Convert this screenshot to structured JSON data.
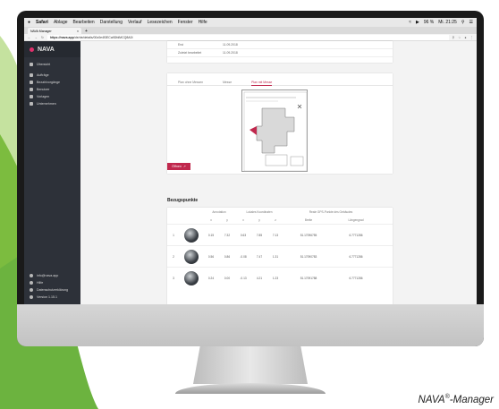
{
  "menubar": {
    "app": "Safari",
    "items": [
      "Ablage",
      "Bearbeiten",
      "Darstellung",
      "Verlauf",
      "Lesezeichen",
      "Fenster",
      "Hilfe"
    ],
    "battery": "96 %",
    "clock": "Mi. 21:25"
  },
  "browser": {
    "tab_title": "NAVA Manager",
    "url_domain": "https://nava.app",
    "url_path": "/de/de/details/00c0e4f3ECa9DfdMCQ8A0l"
  },
  "sidebar": {
    "brand": "NAVA",
    "items": [
      {
        "label": "Übersicht"
      },
      {
        "label": "Aufträge"
      },
      {
        "label": "Bezahlvorgänge"
      },
      {
        "label": "Benutzer"
      },
      {
        "label": "Vorlagen"
      },
      {
        "label": "Unternehmen"
      }
    ],
    "footer": [
      {
        "label": "info@nava.app"
      },
      {
        "label": "Hilfe"
      },
      {
        "label": "Datenschutzerklärung"
      },
      {
        "label": "Version 1.15.1"
      }
    ]
  },
  "info": {
    "rows": [
      {
        "key": "Erst",
        "value": "11.09.2018"
      },
      {
        "key": "Zuletzt bearbeitet",
        "value": "11.09.2018"
      }
    ]
  },
  "plan_tabs": [
    "Plan ohne Messen",
    "Messe",
    "Plan mit Messe"
  ],
  "plan_tabs_active": 2,
  "open_button": "Öffnen",
  "bezugspunkte": {
    "title": "Bezugspunkte",
    "group_headers": [
      "Annotation",
      "Lokales Koordinaten",
      "Reale GPS-Punkte des Gebäudes"
    ],
    "sub_headers": [
      "x",
      "y",
      "x",
      "y",
      "z",
      "Breite",
      "Längengrad"
    ],
    "rows": [
      {
        "index": "1",
        "values": [
          "0.15",
          "7.32",
          "0.63",
          "7.85",
          "7.13",
          "51.17096755",
          "6.7771286"
        ]
      },
      {
        "index": "2",
        "values": [
          "0.56",
          "0.86",
          "-0.08",
          "7.47",
          "1.31",
          "51.17090783",
          "6.7771286"
        ]
      },
      {
        "index": "3",
        "values": [
          "0.24",
          "0.00",
          "-0.13",
          "4.21",
          "1.23",
          "51.17091788",
          "6.7771286"
        ]
      }
    ]
  },
  "caption": {
    "text": "NAVA",
    "reg": "®",
    "suffix": "-Manager"
  },
  "colors": {
    "accent": "#c0284d",
    "sidebar": "#2d3139",
    "green": "#6cb33f"
  }
}
